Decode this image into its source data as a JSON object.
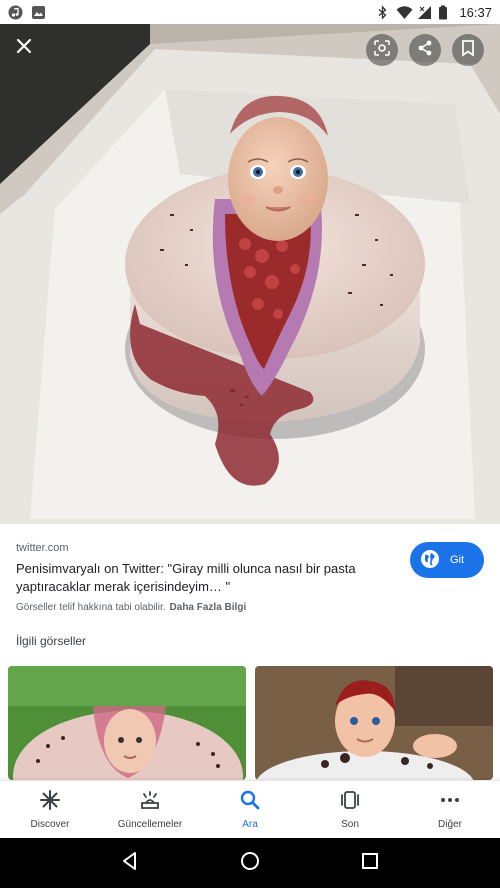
{
  "status_bar": {
    "time": "16:37",
    "left_icons": [
      "music-app-icon",
      "gallery-app-icon"
    ],
    "right_icons": [
      "bluetooth-icon",
      "wifi-icon",
      "signal-icon",
      "battery-icon"
    ]
  },
  "viewer": {
    "close_icon": "close-icon",
    "actions": [
      "lens-icon",
      "share-icon",
      "bookmark-icon"
    ]
  },
  "result": {
    "source": "twitter.com",
    "title": "Penisimvaryalı on Twitter: \"Giray milli olunca nasıl bir pasta yaptıracaklar merak içerisindeyim… \"",
    "visit_label": "Git",
    "visit_icon": "globe-icon",
    "copyright": "Görseller telif hakkına tabi olabilir.",
    "more_info": "Daha Fazla Bilgi",
    "related_title": "İlgili görseller"
  },
  "bottom_nav": {
    "active_color": "#1a73e8",
    "items": [
      {
        "label": "Discover",
        "icon": "asterisk-icon",
        "active": false
      },
      {
        "label": "Güncellemeler",
        "icon": "updates-icon",
        "active": false
      },
      {
        "label": "Ara",
        "icon": "search-icon",
        "active": true
      },
      {
        "label": "Son",
        "icon": "recent-tabs-icon",
        "active": false
      },
      {
        "label": "Diğer",
        "icon": "more-icon",
        "active": false
      }
    ]
  },
  "system_nav": [
    "back-icon",
    "home-icon",
    "recents-icon"
  ]
}
